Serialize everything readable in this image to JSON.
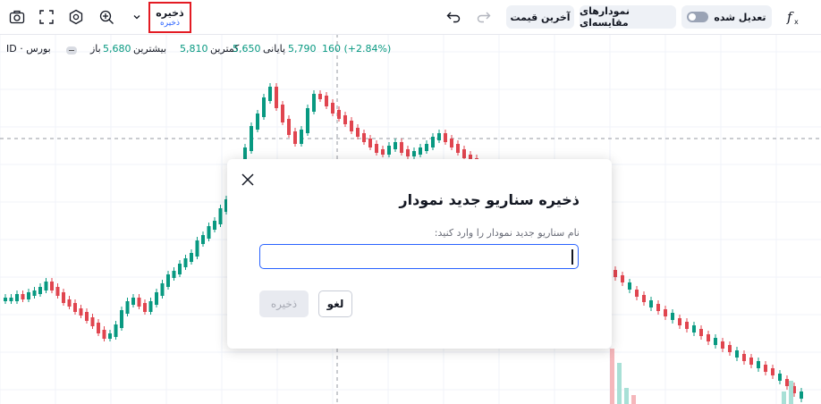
{
  "toolbar": {
    "save_label": "ذخیره",
    "save_sublabel": "ذخیره",
    "adjusted_label": "تعدیل شده",
    "compare_label": "نمودارهای مقایسه‌ای",
    "last_price_label": "آخرین قیمت",
    "formula_icon": "function-icon",
    "icons": [
      "camera-icon",
      "fullscreen-icon",
      "settings-icon",
      "magnet-icon",
      "chevron-down-icon",
      "undo-icon",
      "redo-icon"
    ]
  },
  "legend": {
    "market": "بورس · ID",
    "open_label": "باز",
    "open_value": "5,680",
    "high_label": "بیشترین",
    "high_value": "5,810",
    "low_label": "کمترین",
    "low_value": "5,650",
    "close_label": "پایانی",
    "close_value": "5,790",
    "change": "160 (+2.84%)"
  },
  "dialog": {
    "title": "ذخیره سناریو جدید نمودار",
    "label": "نام سناریو جدید نمودار را وارد کنید:",
    "input_value": "",
    "save_button": "ذخیره",
    "cancel_button": "لغو"
  },
  "colors": {
    "up": "#089981",
    "down": "#e0454f",
    "highlight_border": "#e31b23",
    "accent": "#2962ff"
  }
}
